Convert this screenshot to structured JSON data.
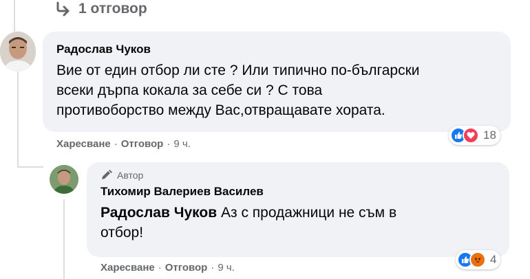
{
  "replies_link": {
    "label": "1 отговор",
    "icon": "reply-arrow-icon"
  },
  "comment": {
    "author": "Радослав Чуков",
    "lines": [
      "Вие от един отбор ли сте ? Или типично по-български",
      "всеки дърпа кокала за себе си ? С това",
      "противоборство между Вас,отвращавате хората."
    ],
    "actions": {
      "like": "Харесване",
      "reply": "Отговор",
      "time": "9 ч."
    },
    "reactions": {
      "types": [
        "like",
        "love"
      ],
      "count": "18"
    }
  },
  "reply": {
    "badge": {
      "icon": "pencil-icon",
      "label": "Автор"
    },
    "author": "Тихомир Валериев Василев",
    "mention": "Радослав Чуков",
    "lines": [
      " Аз с продажници не съм в",
      "отбор!"
    ],
    "actions": {
      "like": "Харесване",
      "reply": "Отговор",
      "time": "9 ч."
    },
    "reactions": {
      "types": [
        "like",
        "angry"
      ],
      "count": "4"
    }
  },
  "colors": {
    "bubble": "#f0f2f5",
    "like": "#1877f2",
    "love": "#f33e58",
    "angry": "#e9710f",
    "secondary_text": "#65676b",
    "thread_line": "#dadde1"
  }
}
